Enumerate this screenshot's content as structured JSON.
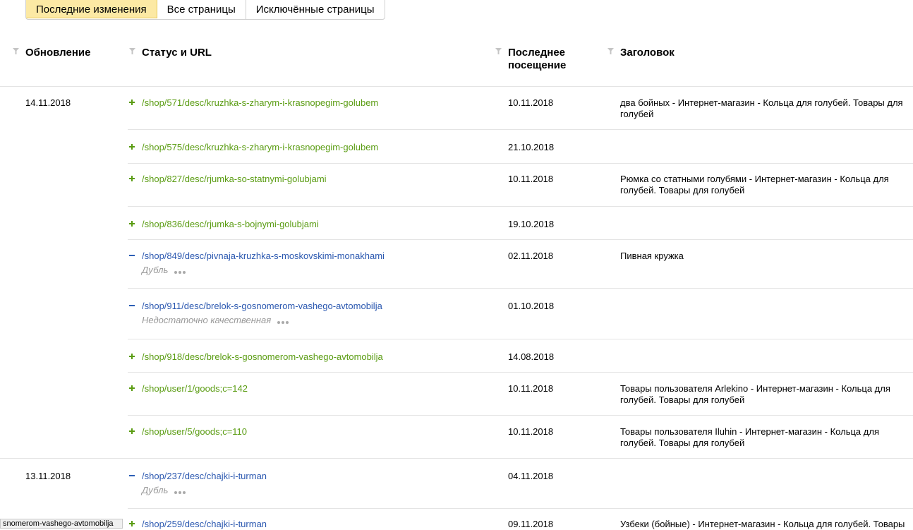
{
  "tabs": [
    {
      "label": "Последние изменения",
      "active": true
    },
    {
      "label": "Все страницы",
      "active": false
    },
    {
      "label": "Исключённые страницы",
      "active": false
    }
  ],
  "columns": {
    "update": "Обновление",
    "status_url": "Статус и URL",
    "last_visit_line1": "Последнее",
    "last_visit_line2": "посещение",
    "title": "Заголовок"
  },
  "groups": [
    {
      "date": "14.11.2018",
      "rows": [
        {
          "sign": "plus",
          "url": "/shop/571/desc/kruzhka-s-zharym-i-krasnopegim-golubem",
          "status": "",
          "visit": "10.11.2018",
          "title": "два бойных - Интернет-магазин - Кольца для голубей. Товары для голубей"
        },
        {
          "sign": "plus",
          "url": "/shop/575/desc/kruzhka-s-zharym-i-krasnopegim-golubem",
          "status": "",
          "visit": "21.10.2018",
          "title": ""
        },
        {
          "sign": "plus",
          "url": "/shop/827/desc/rjumka-so-statnymi-golubjami",
          "status": "",
          "visit": "10.11.2018",
          "title": "Рюмка со статными голубями - Интернет-магазин - Кольца для голубей. Товары для голубей"
        },
        {
          "sign": "plus",
          "url": "/shop/836/desc/rjumka-s-bojnymi-golubjami",
          "status": "",
          "visit": "19.10.2018",
          "title": ""
        },
        {
          "sign": "minus",
          "url": "/shop/849/desc/pivnaja-kruzhka-s-moskovskimi-monakhami",
          "status": "Дубль",
          "visit": "02.11.2018",
          "title": "Пивная кружка"
        },
        {
          "sign": "minus",
          "url": "/shop/911/desc/brelok-s-gosnomerom-vashego-avtomobilja",
          "status": "Недостаточно качественная",
          "visit": "01.10.2018",
          "title": ""
        },
        {
          "sign": "plus",
          "url": "/shop/918/desc/brelok-s-gosnomerom-vashego-avtomobilja",
          "status": "",
          "visit": "14.08.2018",
          "title": ""
        },
        {
          "sign": "plus",
          "url": "/shop/user/1/goods;c=142",
          "status": "",
          "visit": "10.11.2018",
          "title": "Товары пользователя Arlekino - Интернет-магазин - Кольца для голубей. Товары для голубей"
        },
        {
          "sign": "plus",
          "url": "/shop/user/5/goods;c=110",
          "status": "",
          "visit": "10.11.2018",
          "title": "Товары пользователя Iluhin - Интернет-магазин - Кольца для голубей. Товары для голубей"
        }
      ]
    },
    {
      "date": "13.11.2018",
      "rows": [
        {
          "sign": "minus",
          "url": "/shop/237/desc/chajki-i-turman",
          "status": "Дубль",
          "visit": "04.11.2018",
          "title": ""
        },
        {
          "sign": "plus",
          "url": "/shop/259/desc/chajki-i-turman",
          "status": "",
          "visit": "09.11.2018",
          "title": "Узбеки (бойные) - Интернет-магазин - Кольца для голубей. Товары"
        }
      ]
    }
  ],
  "statusbar": "snomerom-vashego-avtomobilja",
  "colors": {
    "added": "#5a9c12",
    "excluded": "#2b58b0",
    "active_tab": "#fce9a4"
  }
}
